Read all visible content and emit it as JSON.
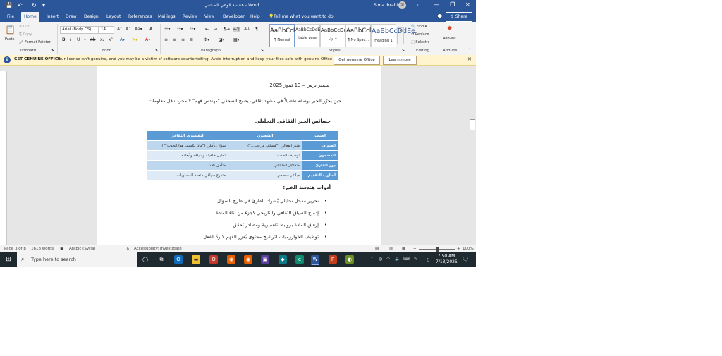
{
  "window": {
    "title": "هندسة الوعي الصحفي - Word",
    "user": "Sima Ibrahim",
    "user_initials": "SI",
    "controls": [
      "—",
      "❐",
      "✕"
    ]
  },
  "ribbon_tabs": [
    "File",
    "Home",
    "Insert",
    "Draw",
    "Design",
    "Layout",
    "References",
    "Mailings",
    "Review",
    "View",
    "Developer",
    "Help"
  ],
  "tell_me": "Tell me what you want to do",
  "share_label": "Share",
  "clipboard": {
    "paste": "Paste",
    "cut": "Cut",
    "copy": "Copy",
    "format_painter": "Format Painter",
    "label": "Clipboard"
  },
  "font": {
    "family": "Arial (Body CS)",
    "size": "14",
    "label": "Font"
  },
  "paragraph": {
    "label": "Paragraph"
  },
  "styles": {
    "label": "Styles",
    "items": [
      {
        "sample": "AaBbCcDdEe",
        "name": "¶ Normal"
      },
      {
        "sample": "AaBbCcDdEe",
        "name": "table para"
      },
      {
        "sample": "AaBbCcDdEe",
        "name": "جدول"
      },
      {
        "sample": "AaBbCcDdEe",
        "name": "¶ No Spac..."
      },
      {
        "sample": "AaBbCcDdEe",
        "name": "Heading 1"
      }
    ]
  },
  "editing": {
    "find": "Find",
    "replace": "Replace",
    "select": "Select",
    "label": "Editing"
  },
  "addins": {
    "name": "Add-ins",
    "label": "Add-ins"
  },
  "message_bar": {
    "heading": "GET GENUINE OFFICE",
    "text": "Your license isn't genuine, and you may be a victim of software counterfeiting. Avoid interruption and keep your files safe with genuine Office today.",
    "button_primary": "Get genuine Office",
    "button_secondary": "Learn more"
  },
  "document": {
    "date_line": "سمير برس – 13 تموز 2025",
    "paragraph": "حين يُحرَّر الخبر بوصفه تفصيلاً في مشهد ثقافي، يصبح الصحفي \"مهندس فهم\" لا مجرد ناقل معلومات.",
    "heading1": "خصائص الخبر الثقافي التحليلي",
    "table": {
      "headers": [
        "العنصر",
        "الشعبوي",
        "التفسيري الثقافي"
      ],
      "rows": [
        [
          "العنوان",
          "مثير انفعالي (\"مُسلم، مرعب...\")",
          "سؤال تأملي (\"ماذا يكشف هذا الحدث؟\")"
        ],
        [
          "المضمون",
          "توصيف الحدث",
          "تحليل خلفيته وسياقه وأبعاده"
        ],
        [
          "دور القارئ",
          "متفاعل انطباعي",
          "متأمل ناقد"
        ],
        [
          "أسلوب التقديم",
          "مباشر سطحي",
          "متدرج سياقي متعدد المستويات"
        ]
      ]
    },
    "heading2": "أدوات هندسة الخبر:",
    "bullets": [
      "تحرير مدخل تحليلي يُشرِك القارئ في طرح السؤال.",
      "إدماج السياق الثقافي والتاريخي كجزء من بناء المادة.",
      "إرفاق المادة بروابط تفسيرية ومصادر تحقق.",
      "توظيف الخوارزميات لترشيح محتوى يُعزز الفهم لا ردّ الفعل."
    ]
  },
  "status_bar": {
    "page": "Page 3 of 8",
    "words": "1618 words",
    "language": "Arabic (Syria)",
    "accessibility": "Accessibility: Investigate",
    "zoom": "100%"
  },
  "taskbar": {
    "search_placeholder": "Type here to search",
    "time": "7:50 AM",
    "date": "7/13/2025",
    "lang": "ع"
  }
}
